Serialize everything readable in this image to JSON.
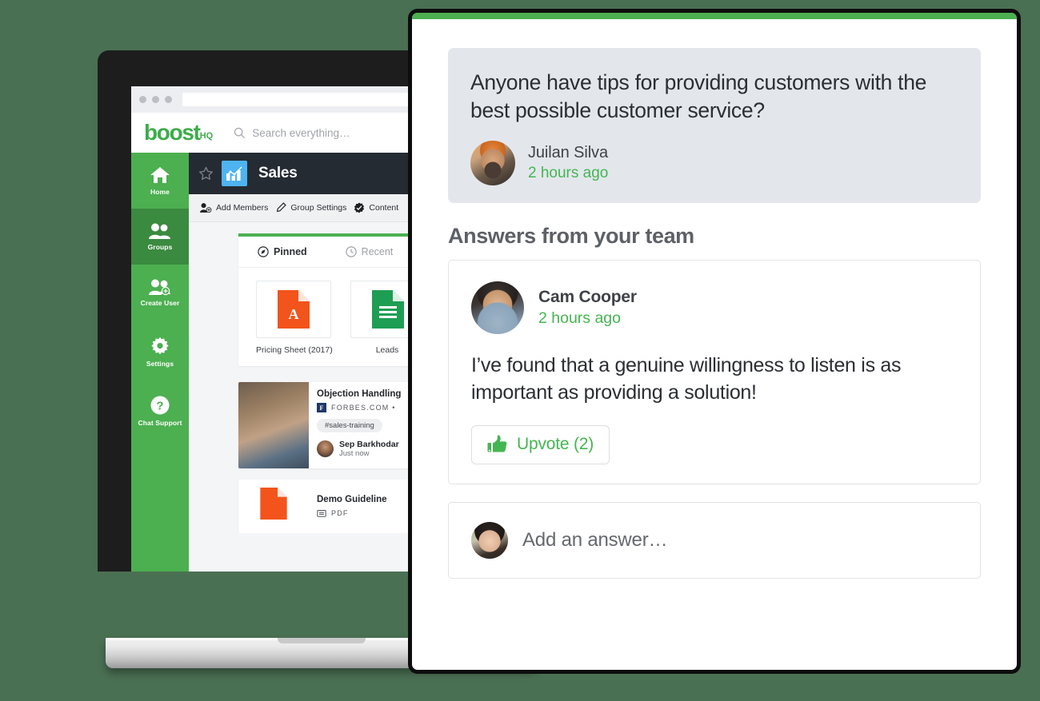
{
  "background_color": "#4a7053",
  "accent_green": "#4caf50",
  "laptop": {
    "browser": {
      "url_value": "",
      "url_placeholder": ""
    },
    "app": {
      "logo_text": "boost",
      "logo_suffix": "HQ",
      "search_placeholder": "Search everything…",
      "sidebar": [
        {
          "label": "Home",
          "icon": "home-icon",
          "active": false
        },
        {
          "label": "Groups",
          "icon": "groups-icon",
          "active": true
        },
        {
          "label": "Create User",
          "icon": "create-user-icon",
          "active": false
        },
        {
          "label": "Settings",
          "icon": "gear-icon",
          "active": false
        },
        {
          "label": "Chat Support",
          "icon": "question-mark-icon",
          "active": false
        }
      ],
      "group": {
        "title": "Sales",
        "star_icon": "star-outline-icon",
        "group_icon": "bar-chart-icon",
        "toolbar": [
          {
            "label": "Add Members",
            "icon": "add-member-icon"
          },
          {
            "label": "Group Settings",
            "icon": "pencil-icon"
          },
          {
            "label": "Content",
            "icon": "verified-badge-icon"
          }
        ]
      },
      "pinned_panel": {
        "tabs": [
          {
            "label": "Pinned",
            "icon": "pin-compass-icon",
            "active": true
          },
          {
            "label": "Recent",
            "icon": "clock-icon",
            "active": false
          }
        ],
        "files": [
          {
            "name": "Pricing Sheet (2017)",
            "icon": "pdf-file-icon",
            "color": "#f2541b"
          },
          {
            "name": "Leads",
            "icon": "spreadsheet-file-icon",
            "color": "#1e9e53"
          }
        ]
      },
      "posts": [
        {
          "title": "Objection Handling",
          "source": "FORBES.COM •",
          "favicon_letter": "F",
          "tag": "#sales-training",
          "author": "Sep Barkhodar",
          "time": "Just now"
        },
        {
          "title": "Demo Guideline",
          "file_type": "PDF",
          "icon": "pdf-file-icon"
        }
      ]
    }
  },
  "modal": {
    "question": {
      "text": "Anyone have tips for providing customers with the best possible customer service?",
      "author": "Juilan Silva",
      "time": "2 hours ago"
    },
    "answers_heading": "Answers from your team",
    "answers": [
      {
        "author": "Cam Cooper",
        "time": "2 hours ago",
        "text": "I’ve found that a genuine willingness to listen is as important as providing a solution!",
        "upvote_label": "Upvote (2)",
        "upvote_icon": "thumbs-up-icon"
      }
    ],
    "composer": {
      "placeholder": "Add an answer…"
    }
  }
}
